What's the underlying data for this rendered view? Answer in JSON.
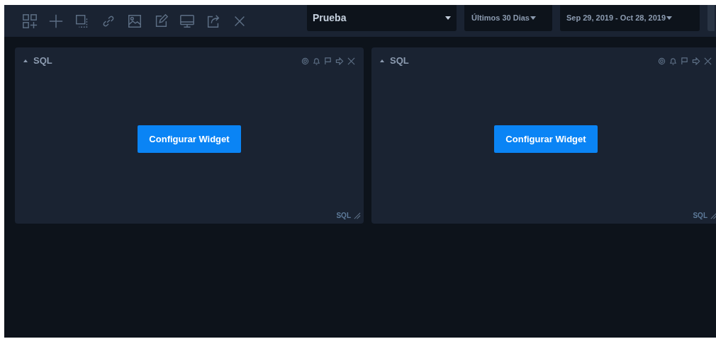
{
  "dashboard_select": {
    "value": "Prueba"
  },
  "range_select": {
    "value": "Últimos 30 Dias"
  },
  "date_select": {
    "value": "Sep 29, 2019 - Oct 28, 2019"
  },
  "widgets": [
    {
      "title": "SQL",
      "button": "Configurar Widget",
      "footer": "SQL"
    },
    {
      "title": "SQL",
      "button": "Configurar Widget",
      "footer": "SQL"
    }
  ]
}
